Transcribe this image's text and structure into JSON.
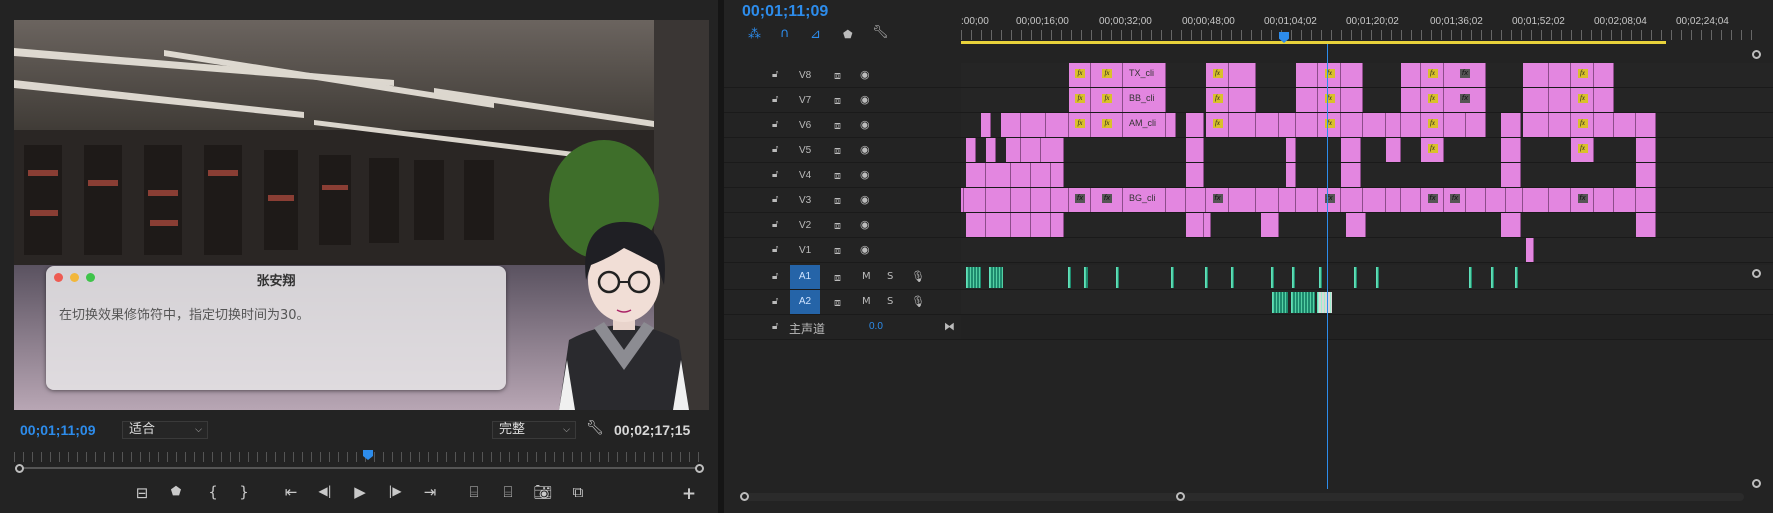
{
  "program": {
    "timecode": "00;01;11;09",
    "fit_label": "适合",
    "quality_label": "完整",
    "duration": "00;02;17;15",
    "dialog": {
      "title": "张安翔",
      "text": "在切换效果修饰符中，指定切换时间为30。"
    },
    "transport": [
      "⊟",
      "⬢",
      "{",
      "}",
      "⇤",
      "◀",
      "▶",
      "▶|",
      "⇥",
      "⌸",
      "⌸",
      "⌷",
      "⧉",
      "+"
    ]
  },
  "timeline": {
    "timecode": "00;01;11;09",
    "ruler": [
      ":00;00",
      "00;00;16;00",
      "00;00;32;00",
      "00;00;48;00",
      "00;01;04;02",
      "00;01;20;02",
      "00;01;36;02",
      "00;01;52;02",
      "00;02;08;04",
      "00;02;24;04"
    ],
    "video_tracks": [
      "V8",
      "V7",
      "V6",
      "V5",
      "V4",
      "V3",
      "V2",
      "V1"
    ],
    "audio_tracks": [
      "A1",
      "A2"
    ],
    "master_label": "主声道",
    "master_value": "0.0",
    "clip_labels": {
      "v8": "TX_cli",
      "v7": "BB_cli",
      "v6": "AM_cli",
      "v3": "BG_cli"
    },
    "fx_label": "fx",
    "track_ms": [
      "M",
      "S"
    ]
  },
  "colors": {
    "accent": "#2d8ceb",
    "video_clip": "#e386e0",
    "audio_clip": "#1e8a6e"
  }
}
